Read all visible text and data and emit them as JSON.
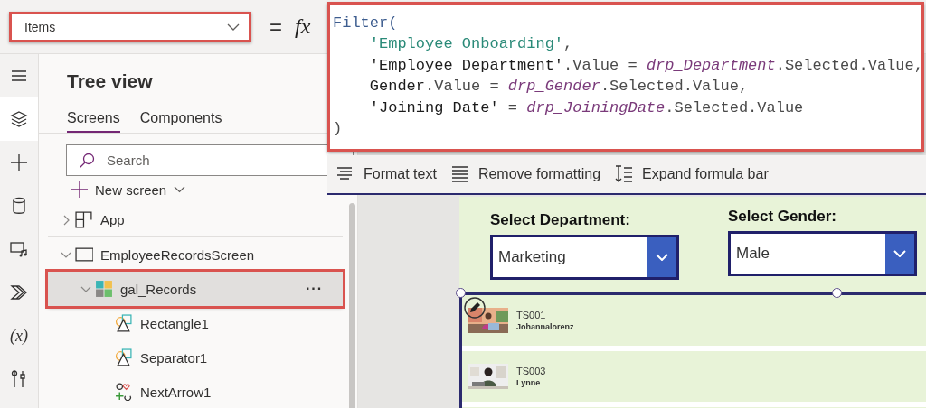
{
  "property_bar": {
    "property": "Items",
    "highlighted": true,
    "equals": "=",
    "fx": "fx"
  },
  "formula": {
    "highlighted": true,
    "lines": [
      {
        "tokens": [
          {
            "kind": "function",
            "text": "Filter("
          }
        ]
      },
      {
        "tokens": [
          {
            "kind": "string",
            "text": "    'Employee Onboarding'"
          },
          {
            "kind": "member",
            "text": ","
          }
        ]
      },
      {
        "tokens": [
          {
            "kind": "name",
            "text": "    'Employee Department'"
          },
          {
            "kind": "member",
            "text": ".Value = "
          },
          {
            "kind": "control",
            "text": "drp_Department"
          },
          {
            "kind": "member",
            "text": ".Selected.Value,"
          }
        ]
      },
      {
        "tokens": [
          {
            "kind": "name",
            "text": "    Gender"
          },
          {
            "kind": "member",
            "text": ".Value = "
          },
          {
            "kind": "control",
            "text": "drp_Gender"
          },
          {
            "kind": "member",
            "text": ".Selected.Value,"
          }
        ]
      },
      {
        "tokens": [
          {
            "kind": "name",
            "text": "    'Joining Date'"
          },
          {
            "kind": "member",
            "text": " = "
          },
          {
            "kind": "control",
            "text": "drp_JoiningDate"
          },
          {
            "kind": "member",
            "text": ".Selected.Value"
          }
        ]
      },
      {
        "tokens": [
          {
            "kind": "member",
            "text": ")"
          }
        ]
      }
    ]
  },
  "toolbar": [
    {
      "kind": "format",
      "label": "Format text"
    },
    {
      "kind": "remove",
      "label": "Remove formatting"
    },
    {
      "kind": "expand",
      "label": "Expand formula bar"
    }
  ],
  "nav_rail": [
    {
      "kind": "menu",
      "selected": false
    },
    {
      "kind": "layers",
      "selected": true
    },
    {
      "kind": "insert",
      "selected": false
    },
    {
      "kind": "data",
      "selected": false
    },
    {
      "kind": "media",
      "selected": false
    },
    {
      "kind": "automate",
      "selected": false
    },
    {
      "kind": "variables",
      "label": "(x)",
      "selected": false
    },
    {
      "kind": "tools",
      "selected": false
    }
  ],
  "tree_view": {
    "title": "Tree view",
    "tabs": [
      {
        "label": "Screens",
        "selected": true
      },
      {
        "label": "Components",
        "selected": false
      }
    ],
    "search": {
      "placeholder": "Search"
    },
    "new_screen": "New screen",
    "items": [
      {
        "kind": "app",
        "label": "App",
        "expanded": false,
        "selected": false
      },
      {
        "kind": "screen",
        "label": "EmployeeRecordsScreen",
        "expanded": true,
        "selected": false,
        "children": [
          {
            "kind": "gallery",
            "label": "gal_Records",
            "expanded": true,
            "selected": true,
            "highlighted": true,
            "more": "···",
            "children": [
              {
                "kind": "shape",
                "label": "Rectangle1",
                "selected": false
              },
              {
                "kind": "shape",
                "label": "Separator1",
                "selected": false
              },
              {
                "kind": "icon",
                "label": "NextArrow1",
                "selected": false
              }
            ]
          }
        ]
      }
    ]
  },
  "canvas": {
    "filters": [
      {
        "label": "Select Department:",
        "value": "Marketing"
      },
      {
        "label": "Select Gender:",
        "value": "Male"
      }
    ],
    "gallery": {
      "selected": true,
      "rows": [
        {
          "title": "TS001",
          "subtitle": "Johannalorenz"
        },
        {
          "title": "TS003",
          "subtitle": "Lynne"
        }
      ]
    }
  }
}
